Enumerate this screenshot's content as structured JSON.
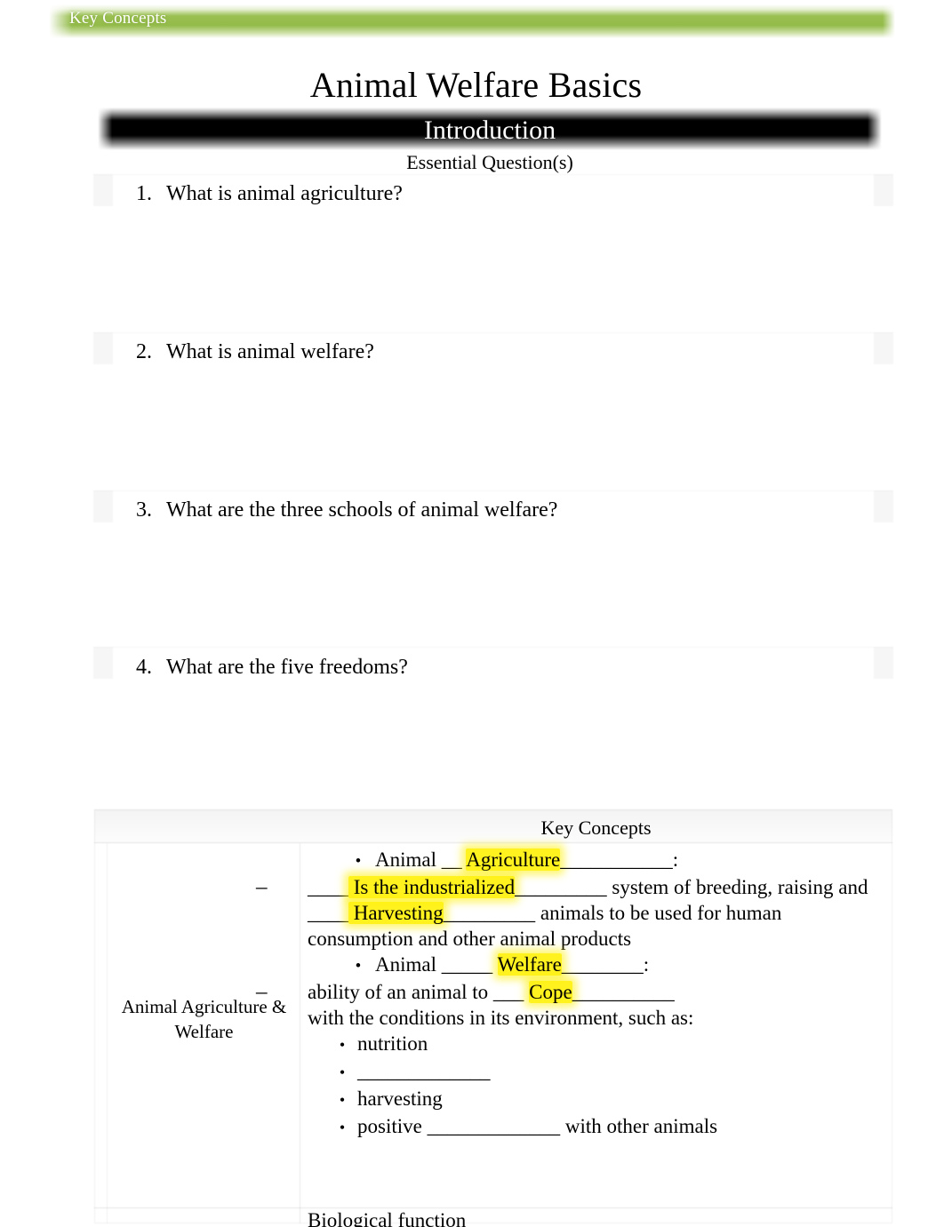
{
  "header": {
    "band_label": "Key Concepts",
    "band_color": "#93bb4a"
  },
  "document": {
    "title": "Animal Welfare Basics",
    "section_band": "Introduction",
    "essential_questions_heading": "Essential Question(s)"
  },
  "questions": [
    {
      "number": "1.",
      "text": "What is animal agriculture?"
    },
    {
      "number": "2.",
      "text": "What is animal welfare?"
    },
    {
      "number": "3.",
      "text": "What are the three schools of animal welfare?"
    },
    {
      "number": "4.",
      "text": "What are the five freedoms?"
    }
  ],
  "key_concepts_table": {
    "header": "Key Concepts",
    "row_label": "Animal Agriculture & Welfare",
    "bullet_glyph": "•",
    "dash_glyph": "–",
    "content": {
      "b1_prefix": "Animal __ ",
      "b1_fill": "Agriculture",
      "b1_blank": "___________",
      "b1_suffix": ":",
      "d1_blank_lead": "____",
      "d1_fill": " Is the industrialized",
      "d1_blank_mid": "_________",
      "d1_text": " system of breeding, raising and ",
      "d2_blank_lead": "____",
      "d2_fill": " Harvesting",
      "d2_blank_mid": "_________",
      "d2_text": " animals to be used for human consumption and other animal products",
      "b2_prefix": "Animal _____ ",
      "b2_fill": "Welfare",
      "b2_blank": "________",
      "b2_suffix": ":",
      "d3_text": "ability of an animal to ___ ",
      "d3_fill": " Cope",
      "d3_blank": "__________",
      "d3_tail": "with the conditions in its environment, such as:",
      "sub_bullets": [
        {
          "text": "nutrition",
          "blank": ""
        },
        {
          "text": "",
          "blank": "_____________"
        },
        {
          "text": "harvesting",
          "blank": ""
        },
        {
          "text": "positive ",
          "blank": "_____________",
          "tail": " with other animals"
        }
      ],
      "cut_off_line": "Biological                    function"
    }
  }
}
